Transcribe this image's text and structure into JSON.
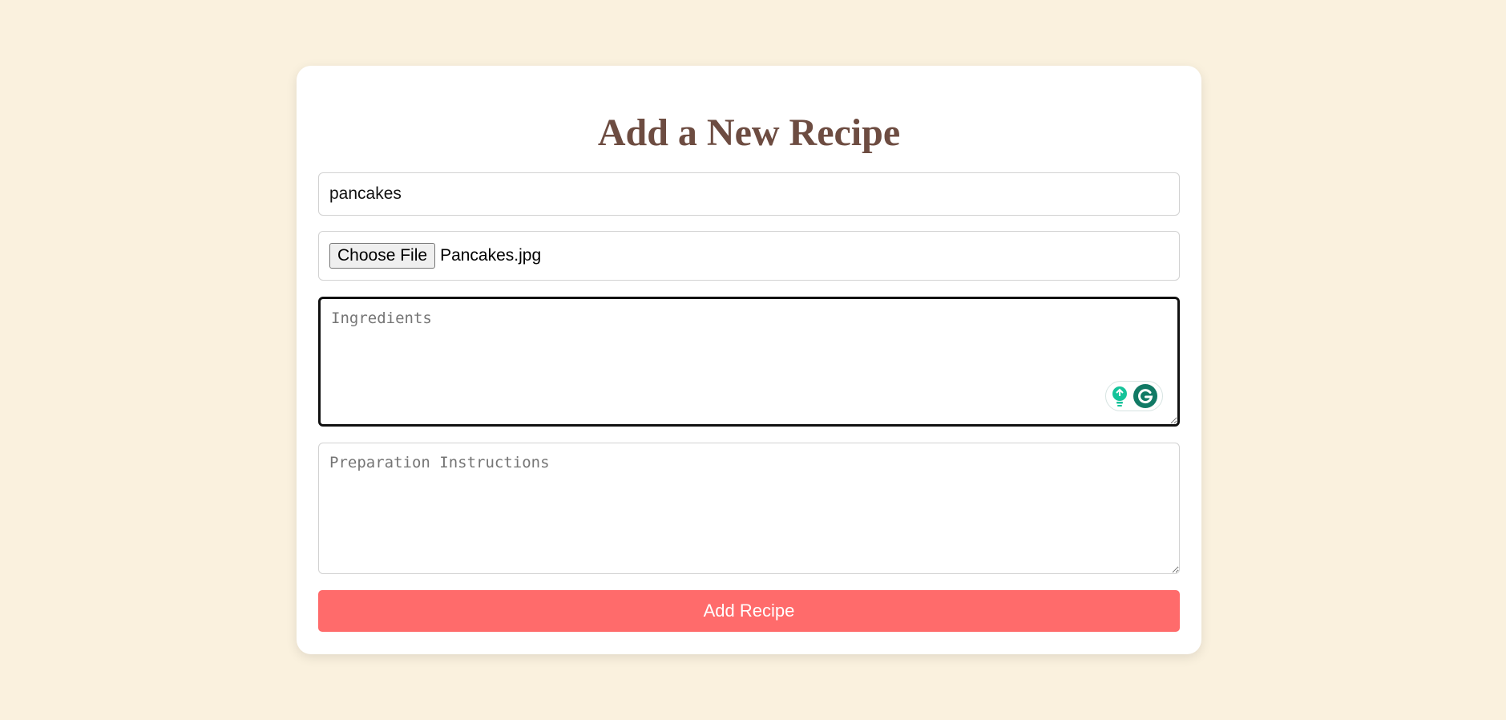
{
  "form": {
    "title": "Add a New Recipe",
    "recipe_name_value": "pancakes",
    "file_button_label": "Choose File",
    "file_name": "Pancakes.jpg",
    "ingredients_placeholder": "Ingredients",
    "instructions_placeholder": "Preparation Instructions",
    "submit_label": "Add Recipe"
  },
  "icons": {
    "grammarly_bulb": "lightbulb-icon",
    "grammarly_logo": "grammarly-g-icon"
  },
  "colors": {
    "page_background": "#faf1de",
    "title": "#6d4c41",
    "submit_button": "#ff6b6b",
    "grammarly_green": "#15c39a"
  }
}
